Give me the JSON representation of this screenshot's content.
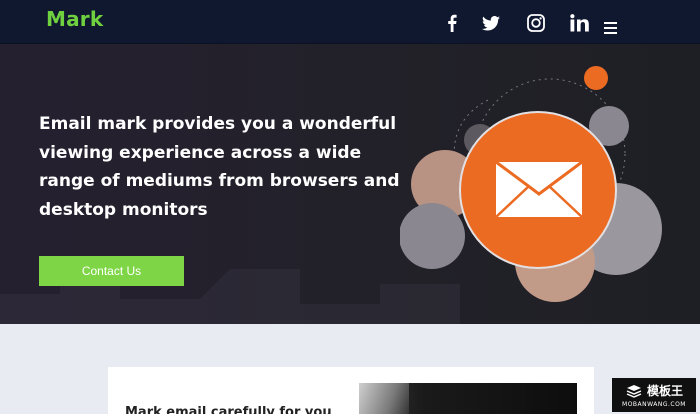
{
  "nav": {
    "brand": "Mark",
    "social_icons": [
      "facebook-icon",
      "twitter-icon",
      "instagram-icon",
      "linkedin-icon"
    ],
    "menu_icon": "hamburger-menu-icon"
  },
  "hero": {
    "headline": "Email mark provides you a wonderful viewing experience across a wide range of mediums from browsers and desktop monitors",
    "cta_label": "Contact Us",
    "illustration_icon": "envelope-icon"
  },
  "section": {
    "card_text": "Mark email carefully for you"
  },
  "watermark": {
    "title": "模板王",
    "domain": "MOBANWANG.COM"
  },
  "colors": {
    "nav_bg": "#101830",
    "brand_green": "#6fd13f",
    "cta_green": "#7ed646",
    "accent_orange": "#ec6b22",
    "hero_bg": "#232029",
    "page_bg": "#e8ecf2"
  }
}
